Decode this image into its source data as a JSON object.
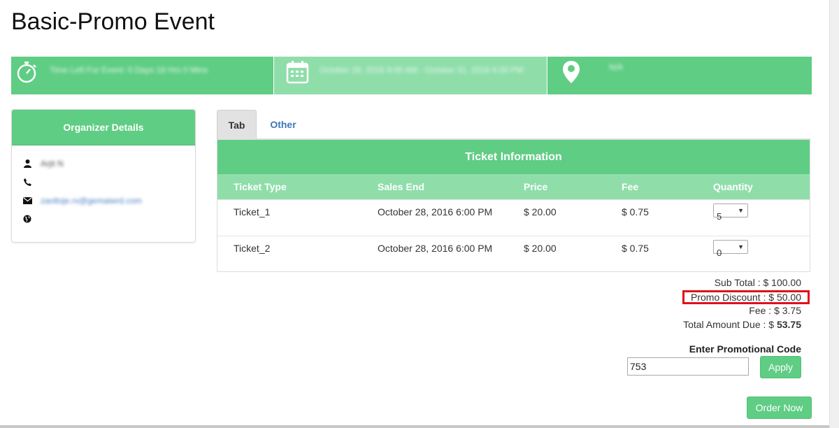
{
  "page": {
    "title": "Basic-Promo Event"
  },
  "info_bar": {
    "time_left": "Time Left For Event: 0 Days 18 Hrs 0 Mins",
    "dates": "October 28, 2016 9:00 AM - October 31, 2016 6:00 PM",
    "location": "N/A",
    "icons": [
      "stopwatch-icon",
      "calendar-icon",
      "map-pin-icon"
    ]
  },
  "organizer": {
    "heading": "Organizer Details",
    "name": "Arjit N",
    "phone": "",
    "email": "zaoltoje.rx@gemaiwrd.com",
    "website": "",
    "icons": [
      "user-icon",
      "phone-icon",
      "envelope-icon",
      "globe-icon"
    ]
  },
  "tabs": [
    {
      "label": "Tab",
      "active": true
    },
    {
      "label": "Other",
      "active": false
    }
  ],
  "tickets": {
    "heading": "Ticket Information",
    "columns": [
      "Ticket Type",
      "Sales End",
      "Price",
      "Fee",
      "Quantity"
    ],
    "rows": [
      {
        "type": "Ticket_1",
        "sales_end": "October 28, 2016 6:00 PM",
        "price": "$ 20.00",
        "fee": "$ 0.75",
        "quantity": "5"
      },
      {
        "type": "Ticket_2",
        "sales_end": "October 28, 2016 6:00 PM",
        "price": "$ 20.00",
        "fee": "$ 0.75",
        "quantity": "0"
      }
    ]
  },
  "summary": {
    "sub_total": "Sub Total : $ 100.00",
    "promo_discount": "Promo Discount : $ 50.00",
    "fee": "Fee : $ 3.75",
    "total_label": "Total Amount Due : $ ",
    "total_value": "53.75"
  },
  "promo": {
    "label": "Enter Promotional Code",
    "code": "753",
    "apply_label": "Apply"
  },
  "order_label": "Order Now",
  "colors": {
    "accent": "#5fcd84",
    "accent_light": "#8fdeaa",
    "highlight_border": "#e0111b",
    "link": "#3d79b8"
  }
}
